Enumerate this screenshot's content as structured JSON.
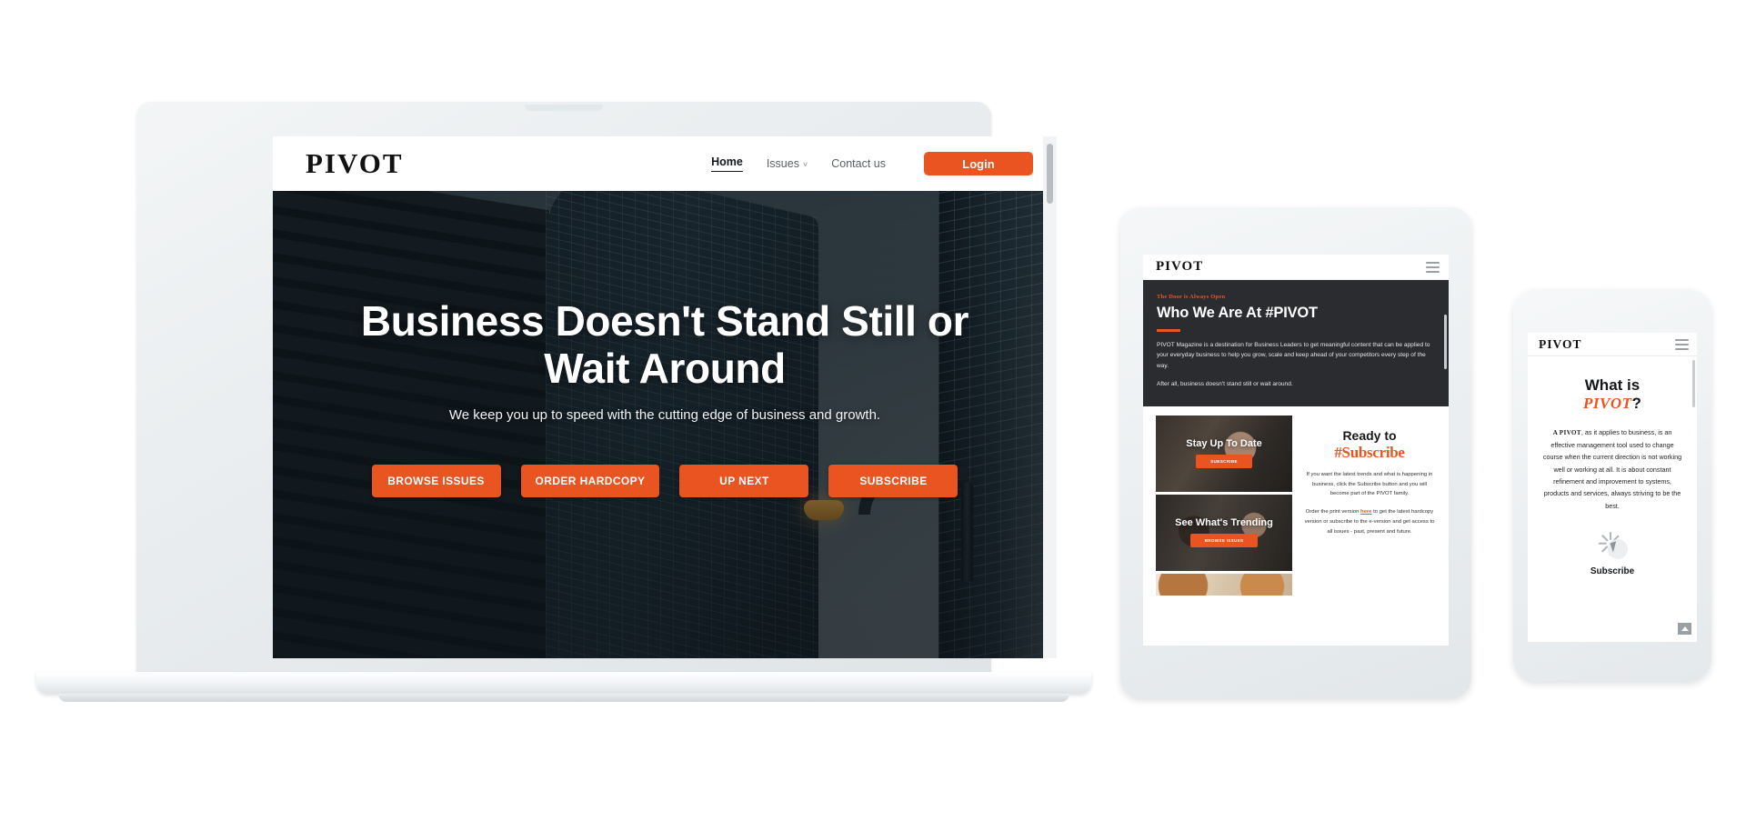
{
  "brand": {
    "name": "PIVOT",
    "accent": "#ea5420",
    "dark": "#2b2c30"
  },
  "laptop": {
    "nav": {
      "logo": "PIVOT",
      "links": [
        {
          "label": "Home",
          "active": true
        },
        {
          "label": "Issues",
          "caret": "˅",
          "active": false
        },
        {
          "label": "Contact us",
          "active": false
        }
      ],
      "login_label": "Login"
    },
    "hero": {
      "heading": "Business Doesn't Stand Still or Wait Around",
      "subheading": "We keep you up to speed with the cutting edge of business and growth.",
      "ctas": [
        "BROWSE ISSUES",
        "ORDER HARDCOPY",
        "UP NEXT",
        "SUBSCRIBE"
      ]
    }
  },
  "tablet": {
    "nav": {
      "logo": "PIVOT",
      "menu_icon": "hamburger-icon"
    },
    "about": {
      "eyebrow": "The Door is Always Open",
      "heading": "Who We Are At #PIVOT",
      "paragraph_1": "PIVOT  Magazine is a destination for Business Leaders to get meaningful content that can be applied to your everyday business to help you grow, scale and keep ahead of your competitors every step of the way.",
      "paragraph_2": "After all, business doesn't stand still or wait around."
    },
    "cards": [
      {
        "title": "Stay Up To Date",
        "button": "SUBSCRIBE"
      },
      {
        "title": "See What's Trending",
        "button": "BROWSE ISSUES"
      }
    ],
    "subscribe": {
      "line1": "Ready to",
      "line2": "#Subscribe",
      "paragraph_1": "If you want the latest trends and what is happening in business, click the Subscribe button and you will become part of the PIVOT family.",
      "paragraph_2_pre": "Order the print version ",
      "paragraph_2_link": "here",
      "paragraph_2_post": " to get the latest hardcopy version or subscribe to the e-version and get access to all issues - past, present and future."
    }
  },
  "phone": {
    "nav": {
      "logo": "PIVOT",
      "menu_icon": "hamburger-icon"
    },
    "heading_line1": "What is",
    "heading_accent": "PIVOT",
    "heading_qmark": "?",
    "paragraph_lead": "A PIVOT",
    "paragraph_rest": ", as it applies to business, is an effective management tool used to change course when  the current  direction is not working well or working at all. It is about constant refinement and improvement to systems, products and services, always striving to be the best.",
    "subscribe_label": "Subscribe",
    "scroll_top_icon": "chevron-up-icon",
    "click_icon": "click-cursor-icon"
  }
}
